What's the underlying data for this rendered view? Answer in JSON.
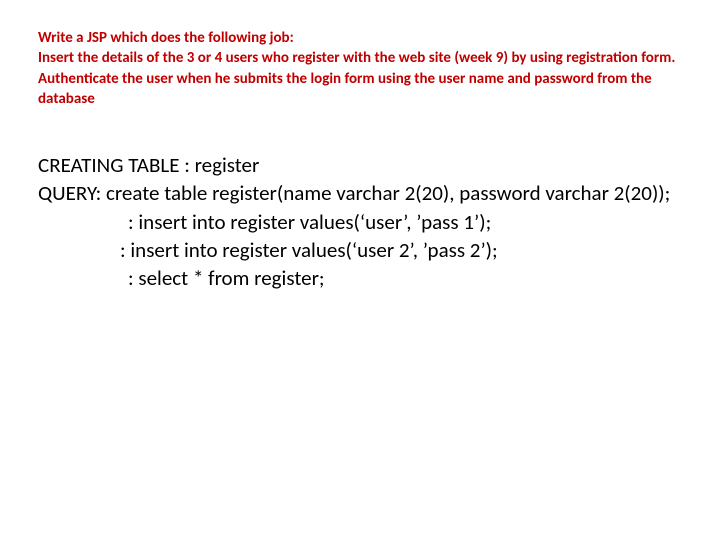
{
  "heading": {
    "l1": "Write a JSP which does the following job:",
    "l2": "Insert the details of the 3 or 4 users who register with the web site (week 9) by using registration form. Authenticate the user when he submits the login form using the user name and password from the database"
  },
  "body": {
    "create_label": "CREATING TABLE : register",
    "query_lead": "QUERY: create table register(name varchar 2(20), password varchar 2(20));",
    "insert1": ": insert into register values(‘user’, ’pass 1’);",
    "insert2": ": insert into register values(‘user 2’, ’pass 2’);",
    "select": ": select * from register;"
  }
}
